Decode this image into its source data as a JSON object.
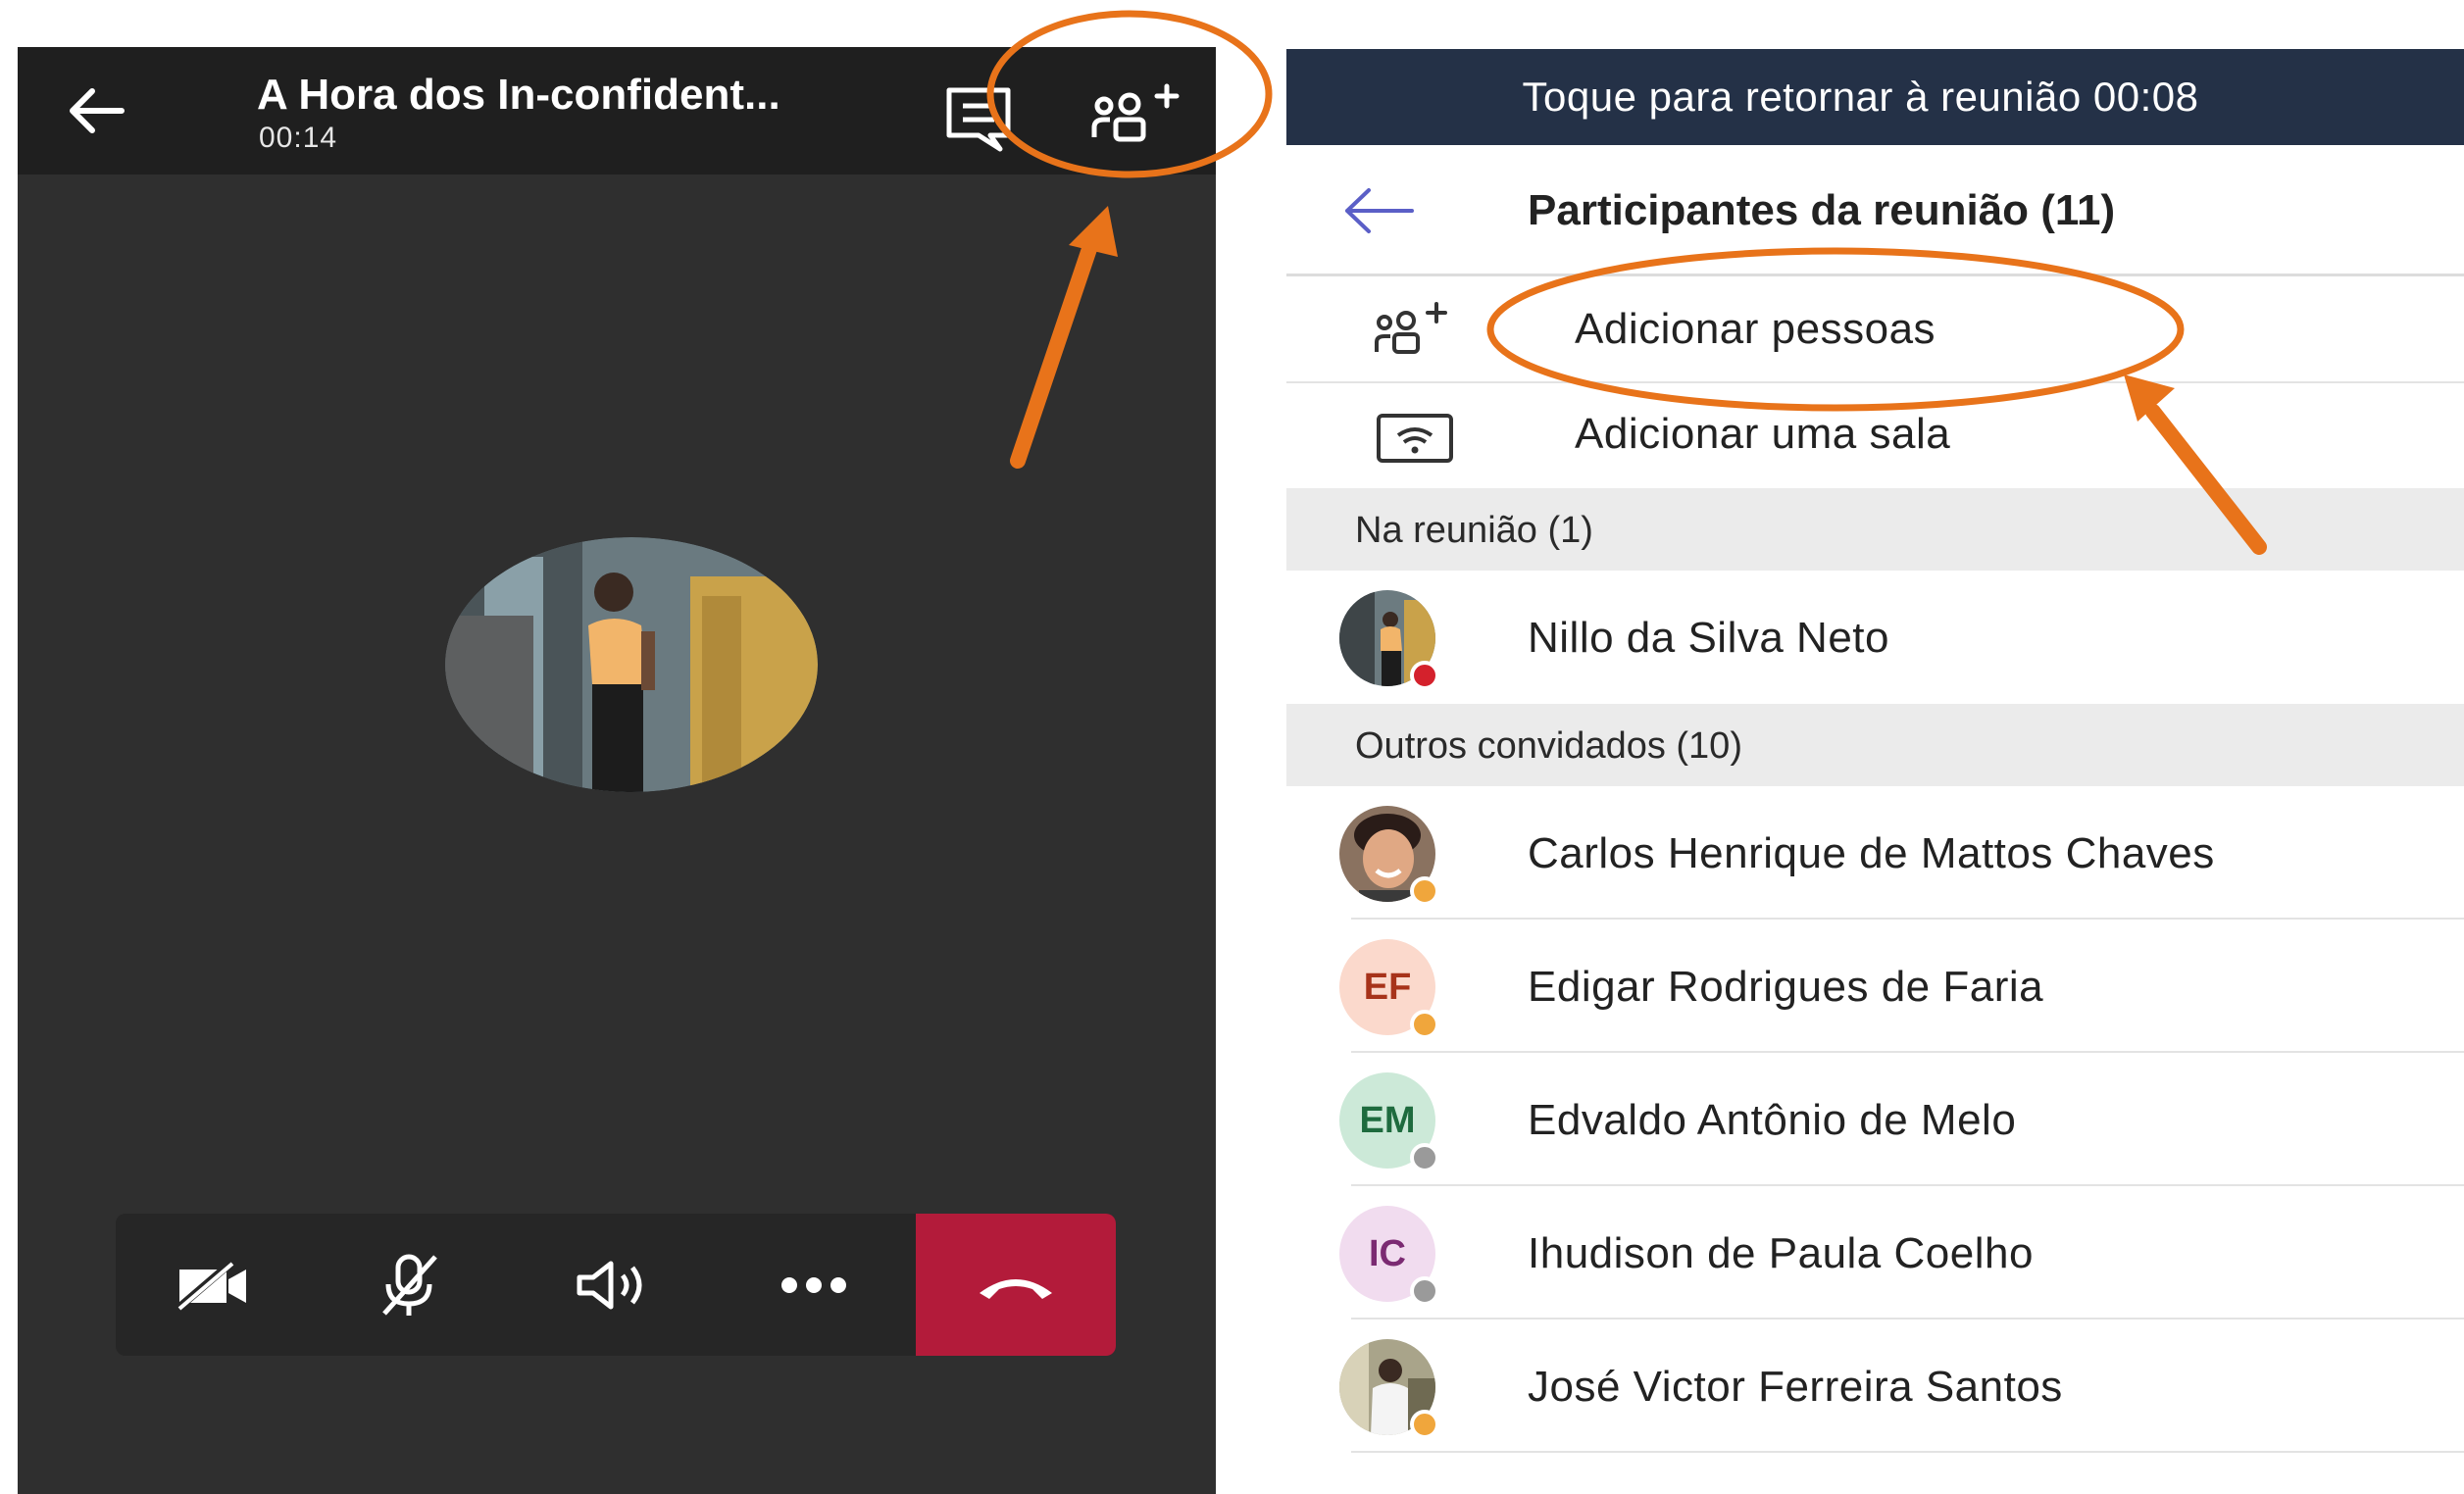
{
  "colors": {
    "call_bg": "#2f2f2f",
    "call_topbar": "#1f1f1f",
    "hangup_red": "#b31b3a",
    "banner_navy": "#243147",
    "annotation_orange": "#e8731a",
    "status_busy": "#d4212c",
    "status_away": "#f0a63c",
    "status_offline": "#9a9a9a"
  },
  "call_screen": {
    "title": "A Hora dos In-confident...",
    "timer": "00:14",
    "icons": {
      "back": "arrow-left-icon",
      "chat": "chat-icon",
      "add_people": "add-people-icon"
    },
    "controls": [
      {
        "name": "camera-off-icon"
      },
      {
        "name": "mic-off-icon"
      },
      {
        "name": "speaker-icon"
      },
      {
        "name": "more-options-icon"
      },
      {
        "name": "hang-up-icon"
      }
    ]
  },
  "participants_screen": {
    "banner": "Toque para retornar à reunião 00:08",
    "title": "Participantes da reunião (11)",
    "actions": [
      {
        "label": "Adicionar pessoas",
        "icon": "add-people-icon"
      },
      {
        "label": "Adicionar uma sala",
        "icon": "room-wifi-icon"
      }
    ],
    "sections": {
      "in_meeting": "Na reunião (1)",
      "others": "Outros convidados (10)"
    },
    "in_meeting": [
      {
        "name": "Nillo  da Silva Neto",
        "status": "busy",
        "avatar": "photo"
      }
    ],
    "others": [
      {
        "name": "Carlos Henrique de Mattos Chaves",
        "status": "away",
        "avatar": "photo"
      },
      {
        "name": "Edigar Rodrigues de Faria",
        "status": "away",
        "initials": "EF"
      },
      {
        "name": "Edvaldo Antônio  de Melo",
        "status": "offline",
        "initials": "EM"
      },
      {
        "name": "Ihudison de Paula Coelho",
        "status": "offline",
        "initials": "IC"
      },
      {
        "name": "José Victor Ferreira  Santos",
        "status": "away",
        "avatar": "photo"
      }
    ]
  }
}
